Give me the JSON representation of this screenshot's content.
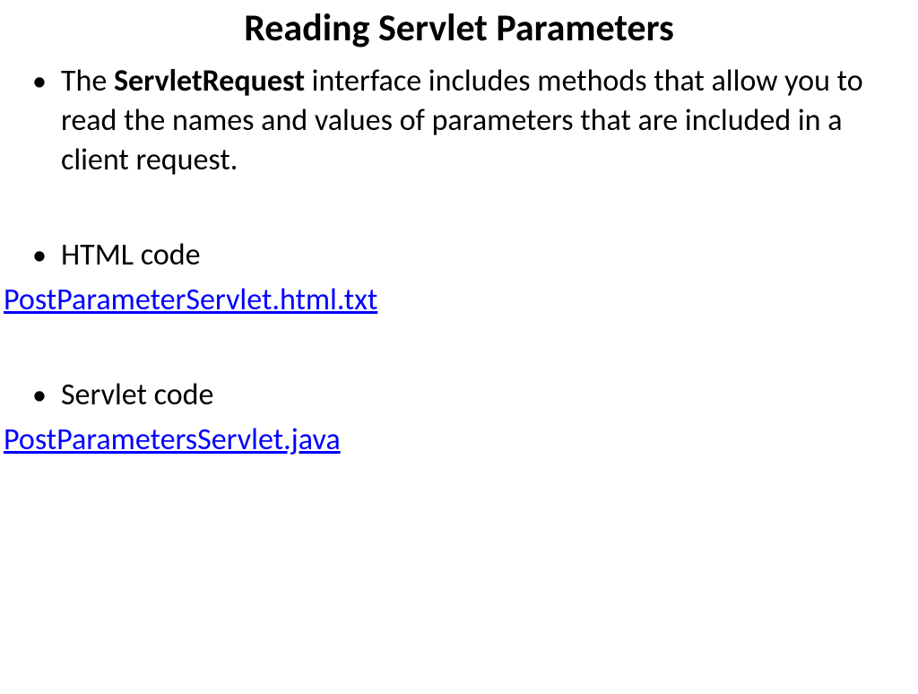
{
  "slide": {
    "title": "Reading Servlet Parameters",
    "bullets": [
      {
        "prefix": "The ",
        "bold": "ServletRequest",
        "suffix": " interface includes methods that allow you to read the names and values of parameters that are included in a client request."
      },
      {
        "text": "HTML code"
      },
      {
        "text": "Servlet code"
      }
    ],
    "links": [
      "PostParameterServlet.html.txt",
      "PostParametersServlet.java"
    ]
  }
}
